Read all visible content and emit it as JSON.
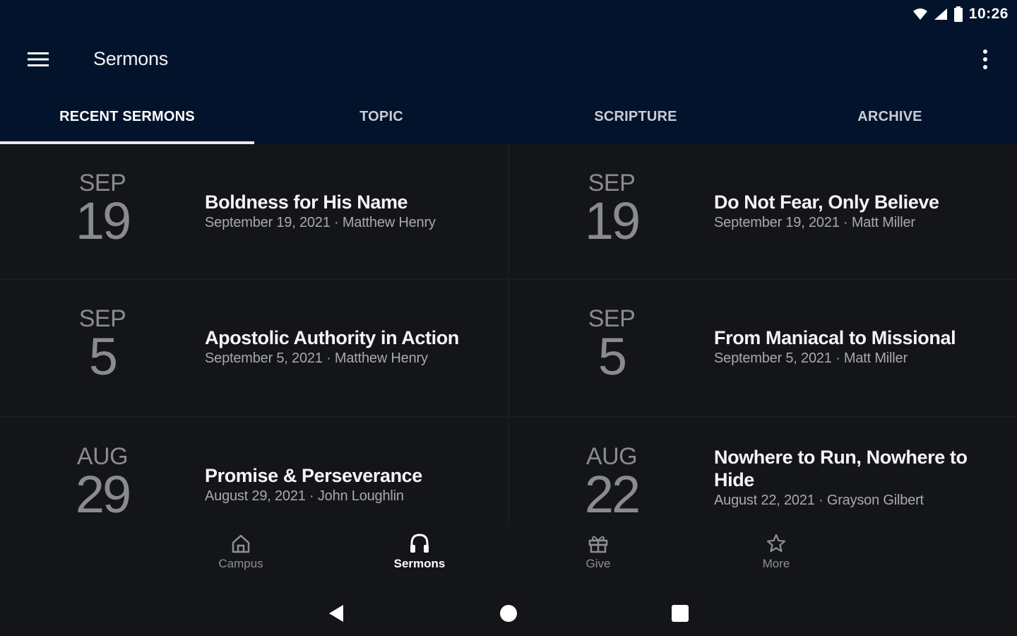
{
  "status_bar": {
    "time": "10:26",
    "icons": [
      "wifi-icon",
      "signal-icon",
      "battery-icon"
    ]
  },
  "app_bar": {
    "title": "Sermons",
    "menu_icon": "menu-icon",
    "overflow_icon": "more-vert-icon"
  },
  "tabs": [
    {
      "label": "RECENT SERMONS",
      "active": true
    },
    {
      "label": "TOPIC",
      "active": false
    },
    {
      "label": "SCRIPTURE",
      "active": false
    },
    {
      "label": "ARCHIVE",
      "active": false
    }
  ],
  "sermons": [
    {
      "month": "SEP",
      "day": "19",
      "title": "Boldness for His Name",
      "meta": "September 19, 2021 · Matthew Henry"
    },
    {
      "month": "SEP",
      "day": "19",
      "title": "Do Not Fear, Only Believe",
      "meta": "September 19, 2021 · Matt Miller"
    },
    {
      "month": "SEP",
      "day": "5",
      "title": "Apostolic Authority in Action",
      "meta": "September 5, 2021 · Matthew Henry"
    },
    {
      "month": "SEP",
      "day": "5",
      "title": "From Maniacal to Missional",
      "meta": "September 5, 2021 · Matt Miller"
    },
    {
      "month": "AUG",
      "day": "29",
      "title": "Promise & Perseverance",
      "meta": "August 29, 2021 · John Loughlin"
    },
    {
      "month": "AUG",
      "day": "22",
      "title": "Nowhere to Run, Nowhere to Hide",
      "meta": "August 22, 2021 · Grayson Gilbert"
    }
  ],
  "bottom_nav": [
    {
      "label": "Campus",
      "icon": "home-icon",
      "active": false
    },
    {
      "label": "Sermons",
      "icon": "headphones-icon",
      "active": true
    },
    {
      "label": "Give",
      "icon": "gift-icon",
      "active": false
    },
    {
      "label": "More",
      "icon": "star-icon",
      "active": false
    }
  ],
  "system_nav": [
    "back-icon",
    "home-circle-icon",
    "recents-icon"
  ],
  "colors": {
    "primary": "#03132c",
    "background": "#141518",
    "muted_text": "#8a8b8e"
  }
}
